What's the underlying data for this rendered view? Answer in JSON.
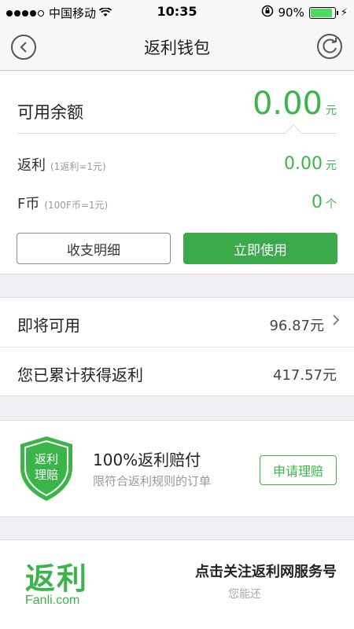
{
  "status_bar": {
    "carrier": "中国移动",
    "time": "10:35",
    "battery": "90%"
  },
  "nav": {
    "title": "返利钱包",
    "back_icon": "chevron-left-circle",
    "refresh_icon": "refresh-circle"
  },
  "wallet": {
    "available_label": "可用余额",
    "available_amount": "0.00",
    "available_unit": "元",
    "rebate_label": "返利",
    "rebate_note": "(1返利=1元)",
    "rebate_amount": "0.00",
    "rebate_unit": "元",
    "fcoin_label": "F币",
    "fcoin_note": "(100F币=1元)",
    "fcoin_amount": "0",
    "fcoin_unit": "个",
    "details_button": "收支明细",
    "use_button": "立即使用",
    "accent_color": "#3bb54a"
  },
  "summary": {
    "upcoming_label": "即将可用",
    "upcoming_value": "96.87元",
    "total_label": "您已累计获得返利",
    "total_value": "417.57元"
  },
  "guarantee": {
    "shield_text_line1": "返利",
    "shield_text_line2": "理赔",
    "title": "100%返利赔付",
    "subtitle": "限符合返利规则的订单",
    "claim_button": "申请理赔"
  },
  "follow": {
    "logo_cn": "返利",
    "logo_en": "Fanli.com",
    "title": "点击关注返利网服务号",
    "subtitle": "您能还"
  }
}
